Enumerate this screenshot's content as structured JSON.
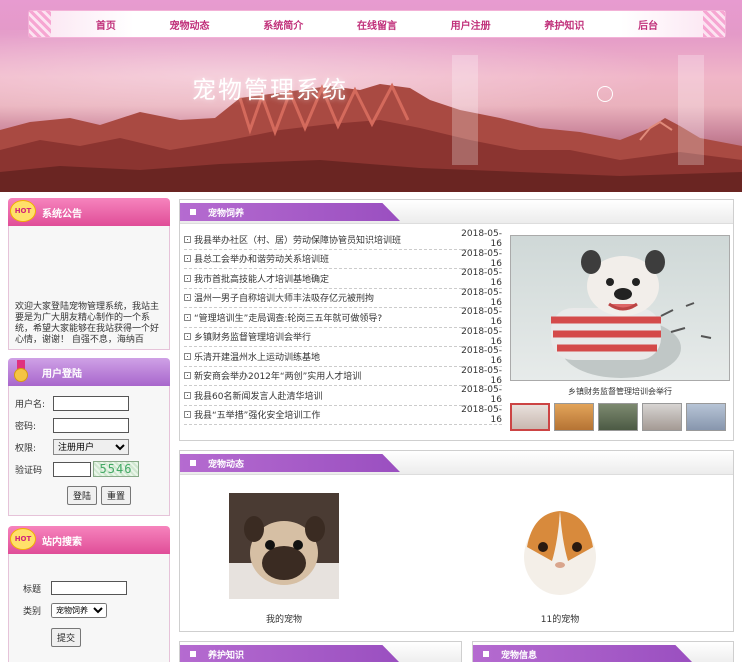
{
  "nav": [
    "首页",
    "宠物动态",
    "系统简介",
    "在线留言",
    "用户注册",
    "养护知识",
    "后台"
  ],
  "site_title": "宠物管理系统",
  "notice": {
    "title": "系统公告",
    "badge": "HOT",
    "text": "欢迎大家登陆宠物管理系统，我站主要是为广大朋友精心制作的一个系统，希望大家能够在我站获得一个好心情，谢谢！ 自强不息，海纳百"
  },
  "login": {
    "title": "用户登陆",
    "username_label": "用户名:",
    "password_label": "密码:",
    "role_label": "权限:",
    "role_value": "注册用户",
    "captcha_label": "验证码",
    "captcha_value": "5546",
    "login_btn": "登陆",
    "reset_btn": "重置"
  },
  "search": {
    "title": "站内搜索",
    "badge": "HOT",
    "title_label": "标题",
    "category_label": "类别",
    "category_value": "宠物饲养",
    "submit_btn": "提交"
  },
  "feeding": {
    "title": "宠物饲养",
    "items": [
      {
        "title": "我县举办社区（村、居）劳动保障协管员知识培训班",
        "date": "2018-05-16"
      },
      {
        "title": "县总工会举办和谐劳动关系培训班",
        "date": "2018-05-16"
      },
      {
        "title": "我市首批高技能人才培训基地确定",
        "date": "2018-05-16"
      },
      {
        "title": "温州一男子自称培训大师丰法吸存亿元被刑拘",
        "date": "2018-05-16"
      },
      {
        "title": "“管理培训生”走局调查:轮岗三五年就可做领导?",
        "date": "2018-05-16"
      },
      {
        "title": "乡镇财务监督管理培训会举行",
        "date": "2018-05-16"
      },
      {
        "title": "乐清开建温州水上运动训练基地",
        "date": "2018-05-16"
      },
      {
        "title": "新安商会举办2012年“两创”实用人才培训",
        "date": "2018-05-16"
      },
      {
        "title": "我县60名新闻发言人赴清华培训",
        "date": "2018-05-16"
      },
      {
        "title": "我县“五举措”强化安全培训工作",
        "date": "2018-05-16"
      }
    ],
    "feature_caption": "乡镇财务监督管理培训会举行"
  },
  "news": {
    "title": "宠物动态",
    "pets": [
      {
        "label": "我的宠物"
      },
      {
        "label": "11的宠物"
      }
    ]
  },
  "care": {
    "title": "养护知识"
  },
  "info": {
    "title": "宠物信息"
  }
}
